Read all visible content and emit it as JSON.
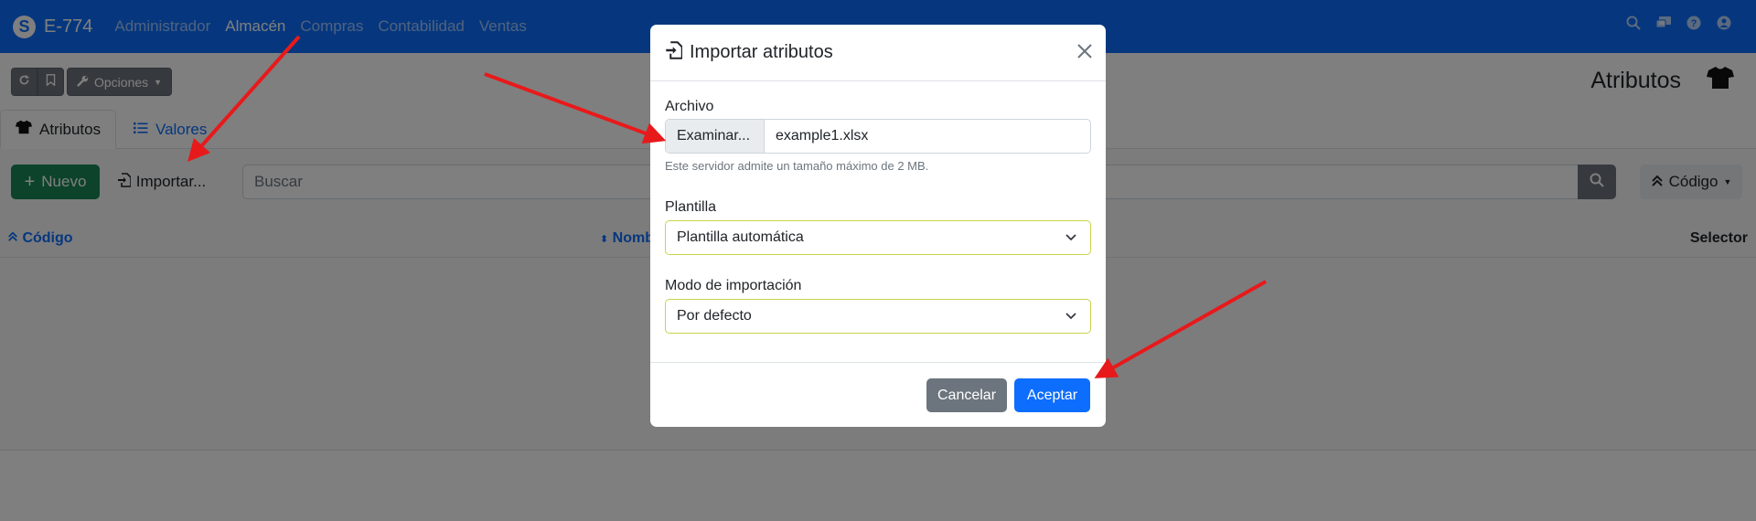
{
  "navbar": {
    "brand_logo": "S",
    "app_name": "E-774",
    "menu": [
      "Administrador",
      "Almacén",
      "Compras",
      "Contabilidad",
      "Ventas"
    ],
    "icons": [
      "search-icon",
      "chat-icon",
      "help-icon",
      "user-icon"
    ]
  },
  "toolbar": {
    "reload_icon": "reload-icon",
    "bookmark_icon": "bookmark-icon",
    "options_label": "Opciones"
  },
  "page": {
    "title": "Atributos",
    "title_icon": "tshirt-icon"
  },
  "tabs": [
    {
      "label": "Atributos",
      "icon": "tshirt-icon",
      "active": true
    },
    {
      "label": "Valores",
      "icon": "list-icon",
      "active": false
    }
  ],
  "actions": {
    "new_label": "Nuevo",
    "import_label": "Importar...",
    "search_placeholder": "Buscar",
    "sort_label": "Código"
  },
  "table": {
    "columns": [
      "Código",
      "Nombre",
      "Selector"
    ]
  },
  "modal": {
    "title": "Importar atributos",
    "file_label": "Archivo",
    "browse_label": "Examinar...",
    "file_name": "example1.xlsx",
    "help_text": "Este servidor admite un tamaño máximo de 2 MB.",
    "template_label": "Plantilla",
    "template_value": "Plantilla automática",
    "mode_label": "Modo de importación",
    "mode_value": "Por defecto",
    "cancel_label": "Cancelar",
    "accept_label": "Aceptar"
  },
  "colors": {
    "primary": "#0d6efd",
    "success": "#198754",
    "secondary": "#6c757d",
    "annotation": "#e8191b"
  }
}
